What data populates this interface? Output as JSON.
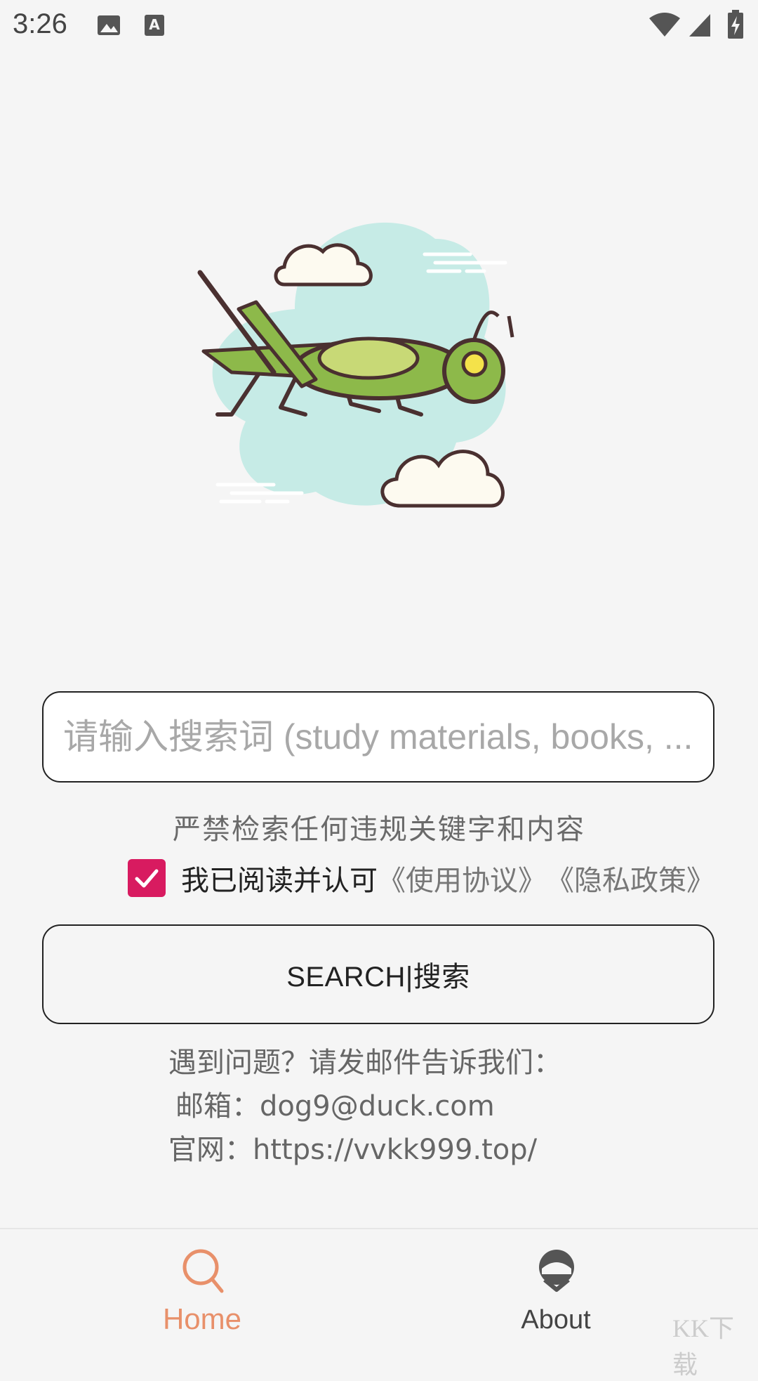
{
  "status_bar": {
    "time": "3:26",
    "icons": [
      "image-notification-icon",
      "text-notification-icon",
      "wifi-icon",
      "signal-icon",
      "battery-charging-icon"
    ]
  },
  "illustration": {
    "icon": "grasshopper-illustration"
  },
  "search": {
    "placeholder": "请输入搜索词 (study materials, books, ..."
  },
  "warning": "严禁检索任何违规关键字和内容",
  "agreement": {
    "checked": true,
    "text": "我已阅读并认可",
    "terms_link": "《使用协议》",
    "privacy_link": "《隐私政策》",
    "accent": "#d81b60"
  },
  "search_button": {
    "label": "SEARCH|搜索"
  },
  "contact": {
    "line1": "遇到问题？请发邮件告诉我们：",
    "line2": "邮箱：dog9@duck.com",
    "line3": "官网：https://vvkk999.top/"
  },
  "bottom_nav": {
    "items": [
      {
        "label": "Home",
        "icon": "search-icon",
        "active": true,
        "color": "#e8906a"
      },
      {
        "label": "About",
        "icon": "about-icon",
        "active": false,
        "color": "#444444"
      }
    ]
  },
  "watermark": "KK下载"
}
